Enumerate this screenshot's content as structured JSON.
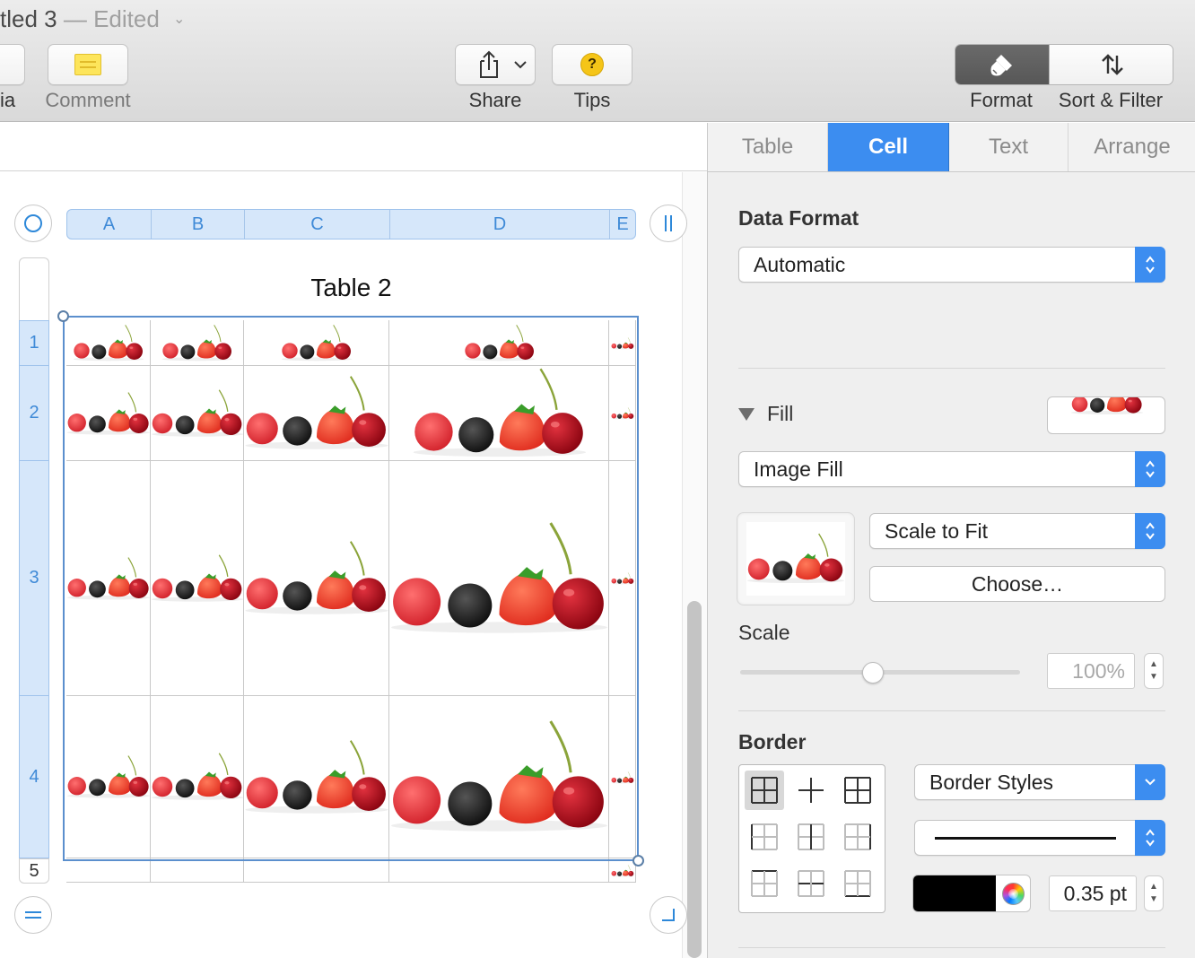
{
  "window": {
    "title": "tled 3",
    "separator": "—",
    "edited": "Edited"
  },
  "toolbar": {
    "media_label": "ia",
    "comment_label": "Comment",
    "share_label": "Share",
    "tips_label": "Tips",
    "tips_glyph": "?",
    "format_label": "Format",
    "sort_filter_label": "Sort & Filter"
  },
  "table": {
    "title": "Table 2",
    "columns": [
      "A",
      "B",
      "C",
      "D",
      "E"
    ],
    "rows": [
      "1",
      "2",
      "3",
      "4",
      "5"
    ],
    "cell_fill": "berries-image"
  },
  "inspector": {
    "tabs": [
      "Table",
      "Cell",
      "Text",
      "Arrange"
    ],
    "active_tab": "Cell",
    "data_format": {
      "label": "Data Format",
      "value": "Automatic"
    },
    "fill": {
      "label": "Fill",
      "type": "Image Fill",
      "scaling": "Scale to Fit",
      "choose_label": "Choose…",
      "scale_label": "Scale",
      "scale_value": "100%",
      "scale_fraction": 1.0
    },
    "border": {
      "label": "Border",
      "style_preset": "Border Styles",
      "color": "#000000",
      "width": "0.35 pt"
    }
  },
  "colors": {
    "accent": "#3c8df0",
    "header_fill": "#d6e7fa",
    "header_text": "#3f8ad7",
    "selection": "#5b8fcd"
  }
}
